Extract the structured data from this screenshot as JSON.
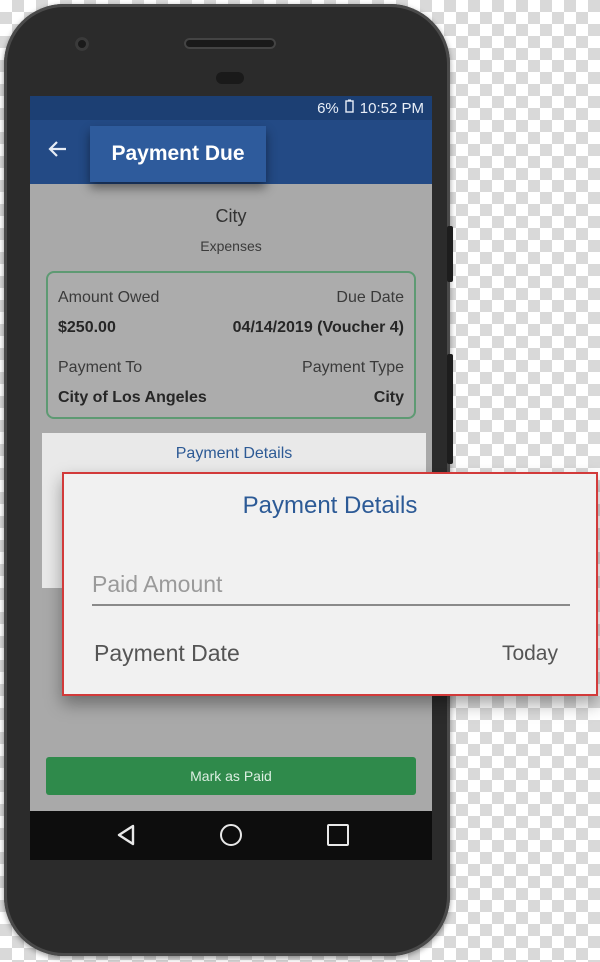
{
  "status_bar": {
    "battery": "6%",
    "time": "10:52 PM"
  },
  "app_bar": {
    "back_icon": "arrow-left-icon",
    "title": "Payment Due"
  },
  "category": {
    "title": "City",
    "subtitle": "Expenses"
  },
  "summary": {
    "amount_owed_label": "Amount Owed",
    "amount_owed_value": "$250.00",
    "due_date_label": "Due Date",
    "due_date_value": "04/14/2019 (Voucher 4)",
    "payment_to_label": "Payment To",
    "payment_to_value": "City of Los Angeles",
    "payment_type_label": "Payment Type",
    "payment_type_value": "City"
  },
  "details": {
    "title": "Payment Details",
    "paid_amount_placeholder": "Paid Amount",
    "payment_date_label": "Payment Date",
    "payment_date_value": "Today"
  },
  "actions": {
    "mark_paid_label": "Mark as Paid"
  },
  "nav": {
    "back_icon": "triangle-back-icon",
    "home_icon": "circle-home-icon",
    "recents_icon": "square-recents-icon"
  },
  "colors": {
    "app_bar": "#234a85",
    "status_bar": "#1c3f73",
    "accent_text": "#2c5a96",
    "mark_paid": "#2f8a4b",
    "card_border": "#5e9a73",
    "callout_border": "#d23a3a"
  }
}
